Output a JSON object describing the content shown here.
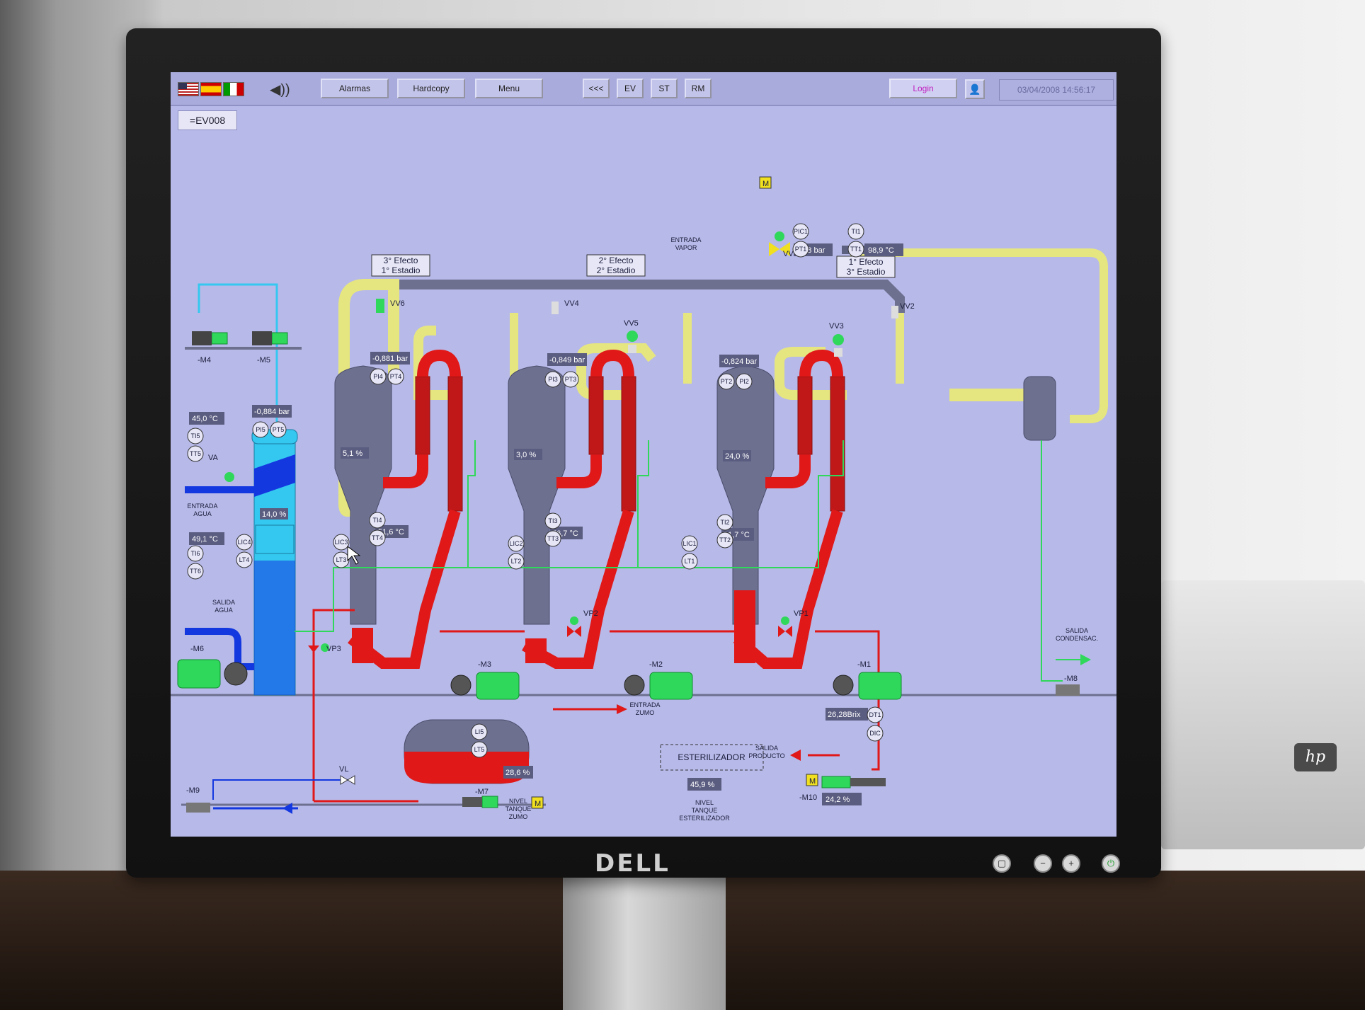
{
  "topbar": {
    "buttons": {
      "alarms": "Alarmas",
      "hardcopy": "Hardcopy",
      "menu": "Menu",
      "back": "<<<",
      "ev": "EV",
      "st": "ST",
      "rm": "RM"
    },
    "login_label": "Login",
    "datetime": "03/04/2008 14:56:17",
    "screen_tag": "=EV008"
  },
  "monitor": {
    "brand": "DELL"
  },
  "printer_brand": "hp",
  "stages": {
    "s3": [
      "3° Efecto",
      "1° Estadio"
    ],
    "s2": [
      "2° Efecto",
      "2° Estadio"
    ],
    "s1": [
      "1° Efecto",
      "3° Estadio"
    ]
  },
  "valves": {
    "vv1": "VV1",
    "vv2": "VV2",
    "vv3": "VV3",
    "vv4": "VV4",
    "vv5": "VV5",
    "vv6": "VV6",
    "va": "VA",
    "vp1": "VP1",
    "vp2": "VP2",
    "vp3": "VP3",
    "vl": "VL"
  },
  "motors": {
    "m1": "-M1",
    "m2": "-M2",
    "m3": "-M3",
    "m4": "-M4",
    "m5": "-M5",
    "m6": "-M6",
    "m7": "-M7",
    "m8": "-M8",
    "m9": "-M9",
    "m10": "-M10",
    "m_box": "M"
  },
  "readings": {
    "steam_pressure": "0,28 bar",
    "steam_temp": "98,9 °C",
    "p_ev3": "-0,881 bar",
    "p_ev2": "-0,849 bar",
    "p_ev1": "-0,824 bar",
    "p_condenser": "-0,884 bar",
    "t_in_water": "45,0 °C",
    "t_out_water": "49,1 °C",
    "level_condenser": "14,0 %",
    "level_ev3": "5,1 %",
    "level_ev2": "3,0 %",
    "level_ev1": "24,0 %",
    "t_ev3": "51,6 °C",
    "t_ev2": "56,7 °C",
    "t_ev1": "61,7 °C",
    "brix": "26,28Brix",
    "level_juice_tank": "28,6 %",
    "level_sterilizer": "45,9 %",
    "m10_speed": "24,2 %"
  },
  "instruments": {
    "pic1": "PIC1",
    "pt1": "PT1",
    "ti1": "TI1",
    "tt1": "TT1",
    "pi4": "PI4",
    "pt4": "PT4",
    "pi3": "PI3",
    "pt3": "PT3",
    "pt2": "PT2",
    "pi2": "PI2",
    "pi5": "PI5",
    "pt5": "PT5",
    "ti5": "TI5",
    "tt5": "TT5",
    "ti6": "TI6",
    "tt6": "TT6",
    "lic4": "LIC4",
    "lt4": "LT4",
    "ti4": "TI4",
    "tt4": "TT4",
    "ti3": "TI3",
    "tt3": "TT3",
    "ti2": "TI2",
    "tt2": "TT2",
    "lic3": "LIC3",
    "lt3": "LT3",
    "lic2": "LIC2",
    "lt2": "LT2",
    "lic1": "LIC1",
    "lt1": "LT1",
    "li5": "LI5",
    "lt5": "LT5",
    "dt1": "DT1",
    "dic": "DIC"
  },
  "texts": {
    "entrada_vapor": [
      "ENTRADA",
      "VAPOR"
    ],
    "entrada_agua": [
      "ENTRADA",
      "AGUA"
    ],
    "salida_agua": [
      "SALIDA",
      "AGUA"
    ],
    "salida_condensado": [
      "SALIDA",
      "CONDENSAC."
    ],
    "entrada_zumo": [
      "ENTRADA",
      "ZUMO"
    ],
    "salida_producto": [
      "SALIDA",
      "PRODUCTO"
    ],
    "esterilizador": "ESTERILIZADOR",
    "nivel_tanque_zumo": [
      "NIVEL",
      "TANQUE",
      "ZUMO"
    ],
    "nivel_tanque_esterilizador": [
      "NIVEL",
      "TANQUE",
      "ESTERILIZADOR"
    ]
  },
  "colors": {
    "screen_bg": "#b7b9e8",
    "steam": "#e6e680",
    "vapor_gray": "#6e7090",
    "product_red": "#e01818",
    "water_blue": "#1438e0",
    "cooling_cyan": "#34c8f0",
    "condensate_green": "#2fd85a"
  }
}
